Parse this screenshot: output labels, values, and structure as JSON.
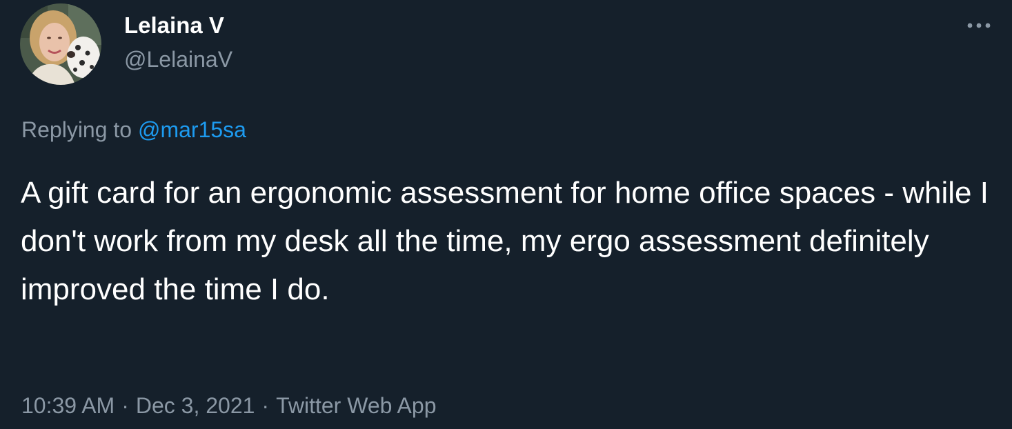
{
  "author": {
    "display_name": "Lelaina V",
    "handle": "@LelainaV"
  },
  "icons": {
    "avatar": "profile-photo-woman-with-dog",
    "more": "more-options-icon"
  },
  "reply": {
    "prefix": "Replying to ",
    "mention": "@mar15sa"
  },
  "tweet": {
    "text": "A gift card for an ergonomic assessment for home office spaces - while I don't work from my desk all the time, my ergo assessment definitely improved the time I do."
  },
  "meta": {
    "time": "10:39 AM",
    "separator": "·",
    "date": "Dec 3, 2021",
    "source": "Twitter Web App"
  },
  "colors": {
    "background": "#15202b",
    "text_primary": "#ffffff",
    "text_secondary": "#8b98a5",
    "link": "#1d9bf0"
  }
}
